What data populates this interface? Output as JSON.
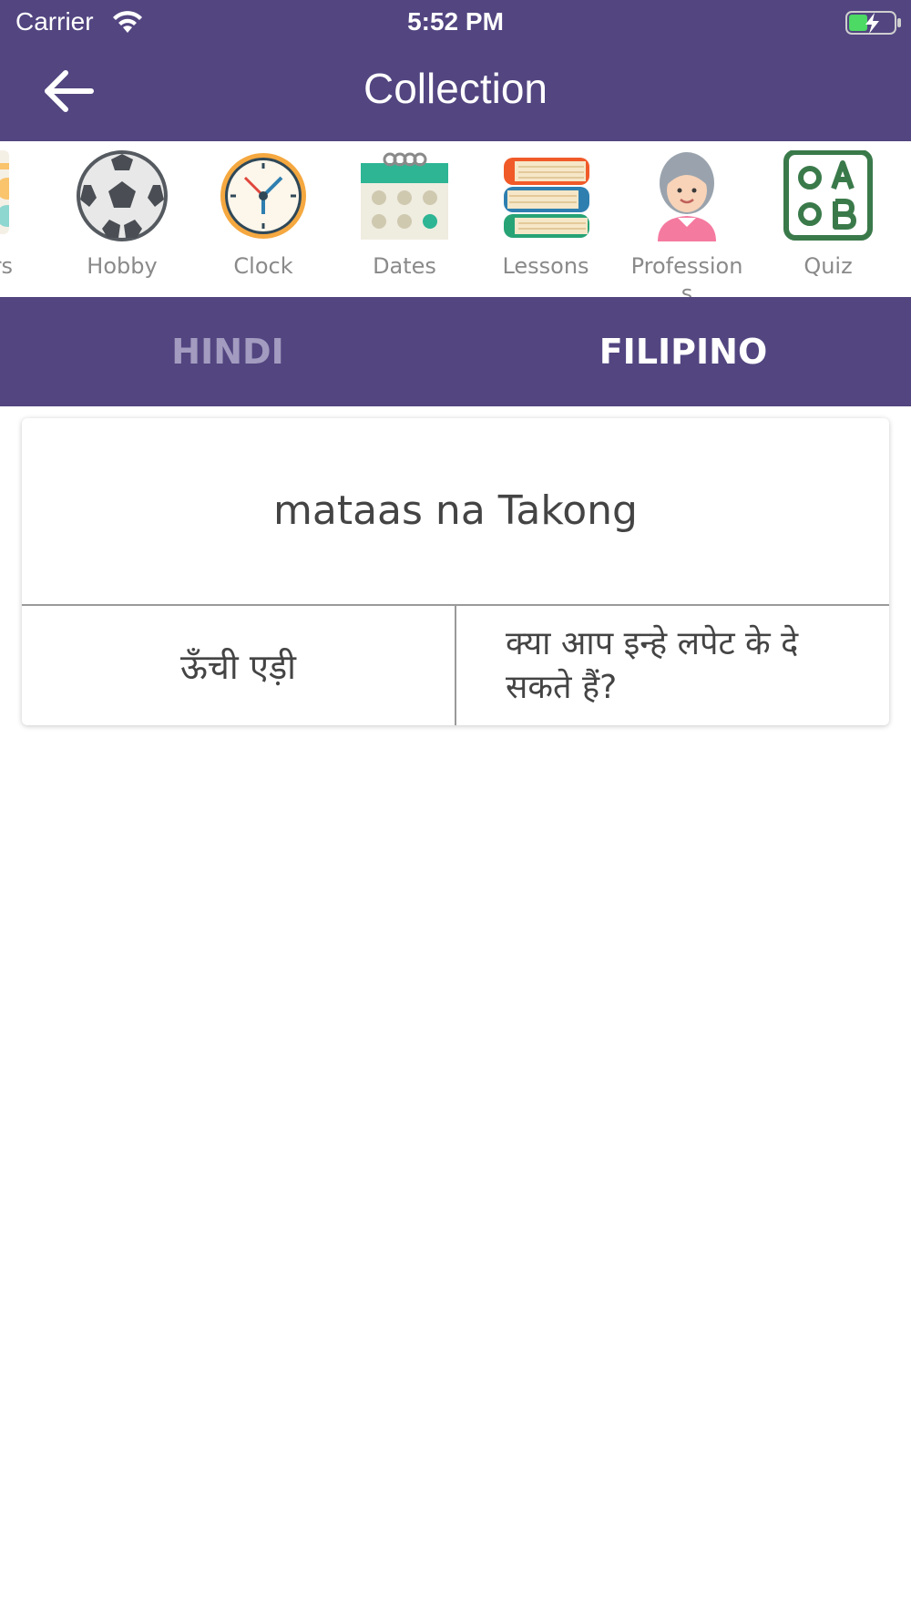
{
  "status_bar": {
    "carrier": "Carrier",
    "time": "5:52 PM"
  },
  "header": {
    "title": "Collection"
  },
  "categories": [
    {
      "label": "rs",
      "icon": "colors-icon"
    },
    {
      "label": "Hobby",
      "icon": "soccer-ball-icon"
    },
    {
      "label": "Clock",
      "icon": "clock-icon"
    },
    {
      "label": "Dates",
      "icon": "calendar-icon"
    },
    {
      "label": "Lessons",
      "icon": "books-icon"
    },
    {
      "label": "Profession\ns",
      "icon": "grandmother-icon"
    },
    {
      "label": "Quiz",
      "icon": "quiz-abc-icon"
    }
  ],
  "tabs": {
    "hindi": "HINDI",
    "filipino": "FILIPINO",
    "active": "filipino"
  },
  "card": {
    "word": "mataas na Takong",
    "translation": "ऊँची एड़ी",
    "example": "क्या आप इन्हे लपेट के दे सकते हैं?"
  },
  "colors": {
    "primary": "#524580",
    "inactive_tab": "#a39cc0",
    "label_gray": "#8a8a8a"
  }
}
